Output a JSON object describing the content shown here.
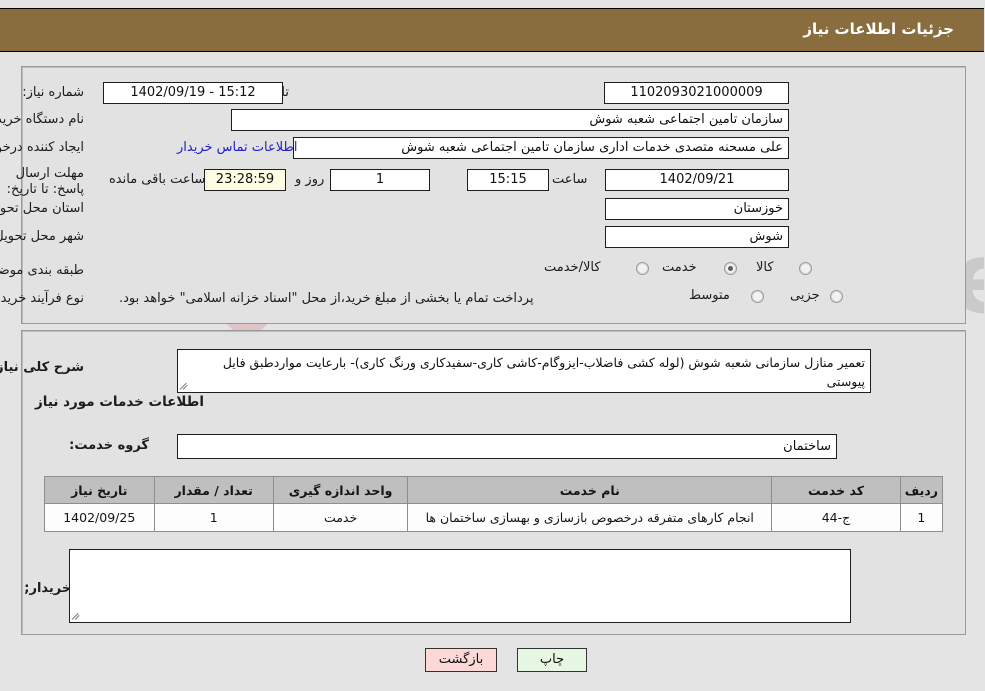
{
  "header": {
    "title": "جزئیات اطلاعات نیاز"
  },
  "form": {
    "need_number_label": "شماره نیاز:",
    "need_number_value": "1102093021000009",
    "public_announce_label": "تاریخ و ساعت اعلان عمومی:",
    "public_announce_value": "15:12 - 1402/09/19",
    "buyer_org_label": "نام دستگاه خریدار:",
    "buyer_org_value": "سازمان تامین اجتماعی شعبه شوش",
    "creator_label": "ایجاد کننده درخواست:",
    "creator_value": "علی مسحنه متصدی خدمات اداری سازمان تامین اجتماعی شعبه شوش",
    "contact_link": "اطلاعات تماس خریدار",
    "deadline_label": "مهلت ارسال پاسخ: تا تاریخ:",
    "deadline_date": "1402/09/21",
    "hour_label": "ساعت",
    "deadline_time": "15:15",
    "days_value": "1",
    "days_label": "روز و",
    "countdown_value": "23:28:59",
    "remaining_label": "ساعت باقی مانده",
    "province_label": "استان محل تحویل:",
    "province_value": "خوزستان",
    "city_label": "شهر محل تحویل:",
    "city_value": "شوش",
    "category_label": "طبقه بندی موضوعی:",
    "category_options": [
      {
        "label": "کالا",
        "selected": false
      },
      {
        "label": "خدمت",
        "selected": true
      },
      {
        "label": "کالا/خدمت",
        "selected": false
      }
    ],
    "process_label": "نوع فرآیند خرید :",
    "process_options": [
      {
        "label": "جزیی",
        "selected": false
      },
      {
        "label": "متوسط",
        "selected": false
      }
    ],
    "payment_note": "پرداخت تمام یا بخشی از مبلغ خرید،از محل \"اسناد خزانه اسلامی\" خواهد بود."
  },
  "description": {
    "label": "شرح کلی نیاز:",
    "value": "تعمیر منازل سازمانی شعبه شوش (لوله کشی فاضلاب-ایزوگام-کاشی کاری-سفیدکاری ورنگ کاری)-  بارعایت مواردطبق فایل پیوستی"
  },
  "services_section": {
    "heading": "اطلاعات خدمات مورد نیاز",
    "group_label": "گروه خدمت:",
    "group_value": "ساختمان"
  },
  "table": {
    "columns": [
      "ردیف",
      "کد خدمت",
      "نام خدمت",
      "واحد اندازه گیری",
      "تعداد / مقدار",
      "تاریخ نیاز"
    ],
    "rows": [
      {
        "radif": "1",
        "code": "ج-44",
        "name": "انجام کارهای متفرقه درخصوص بازسازی و بهسازی ساختمان ها",
        "unit": "خدمت",
        "qty": "1",
        "date": "1402/09/25"
      }
    ]
  },
  "buyer_comments": {
    "label": "توضیحات خریدار;",
    "value": ""
  },
  "buttons": {
    "print": "چاپ",
    "back": "بازگشت"
  },
  "watermark": {
    "text": "AriaTender.net"
  },
  "colors": {
    "header_brown": "#8a6d3f",
    "page_bg": "#e4e4e4",
    "panel_bg": "#e2e2e2",
    "link_blue": "#1f1fc8",
    "timer_bg": "#fdfde4",
    "print_btn_bg": "#e8f6e4",
    "back_btn_bg": "#fcd8d8",
    "table_header_bg": "#bfbfbf"
  }
}
